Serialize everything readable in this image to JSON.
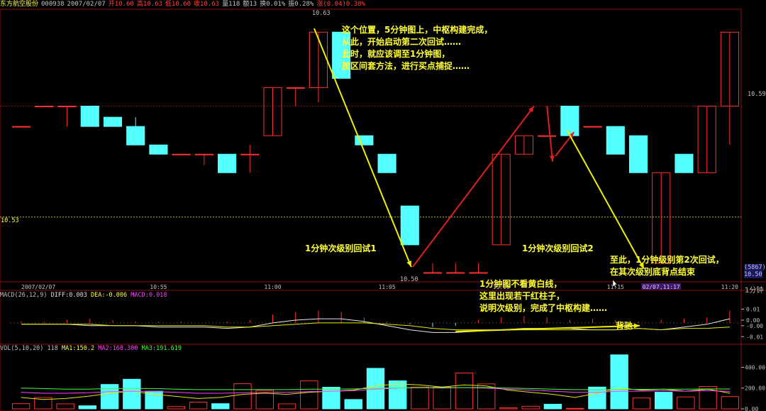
{
  "header": {
    "name": "东方航空股份",
    "code": "000938",
    "date": "2007/02/07",
    "open": "开10.60",
    "high": "高10.63",
    "low": "低10.60",
    "close": "收10.63",
    "volume": "量118",
    "amount": "额13",
    "turnover": "换0.01%",
    "amplitude": "振0.28%",
    "change": "涨(0.04)0.38%"
  },
  "axis": {
    "price_high_label": "10.59",
    "price_mid_label": "10.53",
    "top_candle_label": "10.63",
    "low_label": "10.50",
    "right_box_top": "(5867)",
    "right_box_bottom": "10.50",
    "period": "1分钟",
    "time_labels": [
      "2007/02/07",
      "10:55",
      "11:00",
      "11:05",
      "11:10",
      "11:15",
      "02/07,11:17",
      "11:20"
    ],
    "macd_ticks": [
      "0.01",
      "0.00",
      "-0.00",
      "-0.01"
    ],
    "vol_ticks": [
      "400.00",
      "200.00",
      "0.00"
    ]
  },
  "indicators": {
    "macd_label": "MACD(26,12,9)",
    "diff": "DIFF:0.003",
    "dea": "DEA:-0.006",
    "macd": "MACD:0.018",
    "vol_label": "VOL(5,10,20)",
    "vol_value": "118",
    "ma1": "MA1:150.2",
    "ma2": "MA2:168.300",
    "ma3": "MA3:191.619"
  },
  "annotations": {
    "top": [
      "这个位置，5分钟图上，中枢构建完成，",
      "从此，开始启动第二次回试……",
      "此时，就应该调至1分钟图，",
      "按区间套方法，进行买点捕捉……"
    ],
    "retest1": "1分钟次级别回试1",
    "retest2": "1分钟次级别回试2",
    "end": [
      "至此，1分钟级别第2次回试，",
      "在其次级别底背点结束"
    ],
    "macd_note": [
      "1分钟图不看黄白线，",
      "这里出现若干红柱子，",
      "说明次级别，完成了中枢构建……"
    ],
    "divergence": "背驰"
  },
  "colors": {
    "up": "#ff3030",
    "down": "#54ffff",
    "text": "#c0c0c0",
    "annotation": "#ffff33",
    "grid": "#8a1010"
  },
  "chart_data": {
    "type": "candlestick",
    "ylim": [
      10.495,
      10.642
    ],
    "candles": [
      {
        "o": 10.579,
        "h": 10.579,
        "l": 10.579,
        "c": 10.579
      },
      {
        "o": 10.59,
        "h": 10.59,
        "l": 10.59,
        "c": 10.59
      },
      {
        "o": 10.59,
        "h": 10.59,
        "l": 10.579,
        "c": 10.59
      },
      {
        "o": 10.59,
        "h": 10.59,
        "l": 10.579,
        "c": 10.579
      },
      {
        "o": 10.584,
        "h": 10.584,
        "l": 10.579,
        "c": 10.579
      },
      {
        "o": 10.579,
        "h": 10.584,
        "l": 10.569,
        "c": 10.569
      },
      {
        "o": 10.569,
        "h": 10.569,
        "l": 10.564,
        "c": 10.564
      },
      {
        "o": 10.564,
        "h": 10.564,
        "l": 10.564,
        "c": 10.564
      },
      {
        "o": 10.564,
        "h": 10.564,
        "l": 10.558,
        "c": 10.564
      },
      {
        "o": 10.564,
        "h": 10.564,
        "l": 10.554,
        "c": 10.554
      },
      {
        "o": 10.564,
        "h": 10.569,
        "l": 10.554,
        "c": 10.564
      },
      {
        "o": 10.574,
        "h": 10.6,
        "l": 10.574,
        "c": 10.6
      },
      {
        "o": 10.6,
        "h": 10.6,
        "l": 10.59,
        "c": 10.6
      },
      {
        "o": 10.6,
        "h": 10.63,
        "l": 10.592,
        "c": 10.63
      },
      {
        "o": 10.63,
        "h": 10.63,
        "l": 10.605,
        "c": 10.605
      },
      {
        "o": 10.574,
        "h": 10.574,
        "l": 10.569,
        "c": 10.569
      },
      {
        "o": 10.564,
        "h": 10.564,
        "l": 10.554,
        "c": 10.554
      },
      {
        "o": 10.536,
        "h": 10.536,
        "l": 10.515,
        "c": 10.515
      },
      {
        "o": 10.5,
        "h": 10.505,
        "l": 10.5,
        "c": 10.5
      },
      {
        "o": 10.5,
        "h": 10.505,
        "l": 10.5,
        "c": 10.5
      },
      {
        "o": 10.5,
        "h": 10.505,
        "l": 10.5,
        "c": 10.5
      },
      {
        "o": 10.515,
        "h": 10.564,
        "l": 10.515,
        "c": 10.564
      },
      {
        "o": 10.564,
        "h": 10.574,
        "l": 10.564,
        "c": 10.574
      },
      {
        "o": 10.574,
        "h": 10.574,
        "l": 10.574,
        "c": 10.574
      },
      {
        "o": 10.59,
        "h": 10.59,
        "l": 10.574,
        "c": 10.574
      },
      {
        "o": 10.579,
        "h": 10.579,
        "l": 10.579,
        "c": 10.579
      },
      {
        "o": 10.579,
        "h": 10.579,
        "l": 10.564,
        "c": 10.564
      },
      {
        "o": 10.574,
        "h": 10.574,
        "l": 10.554,
        "c": 10.554
      },
      {
        "o": 10.505,
        "h": 10.554,
        "l": 10.505,
        "c": 10.554
      },
      {
        "o": 10.564,
        "h": 10.564,
        "l": 10.554,
        "c": 10.554
      },
      {
        "o": 10.554,
        "h": 10.59,
        "l": 10.554,
        "c": 10.59
      },
      {
        "o": 10.59,
        "h": 10.63,
        "l": 10.569,
        "c": 10.63
      }
    ],
    "macd": {
      "ylim": [
        -0.014,
        0.018
      ],
      "bars": [
        0.001,
        0.001,
        0.002,
        0.003,
        0.002,
        0.001,
        0.001,
        0.001,
        0.0,
        0.001,
        0.002,
        0.006,
        0.008,
        0.009,
        0.008,
        0.004,
        0.001,
        -0.001,
        -0.003,
        -0.002,
        0.002,
        0.004,
        0.005,
        0.004,
        0.002,
        0.003,
        0.002,
        0.001,
        0.002,
        0.003,
        0.004,
        0.009
      ],
      "diff": [
        -0.001,
        -0.001,
        -0.001,
        -0.002,
        -0.002,
        -0.002,
        -0.003,
        -0.003,
        -0.003,
        -0.004,
        -0.003,
        0.0,
        0.002,
        0.003,
        0.003,
        0.001,
        -0.002,
        -0.005,
        -0.007,
        -0.007,
        -0.006,
        -0.005,
        -0.004,
        -0.004,
        -0.004,
        -0.005,
        -0.005,
        -0.004,
        -0.005,
        -0.003,
        -0.001,
        0.003
      ],
      "dea": [
        -0.001,
        -0.001,
        -0.001,
        -0.001,
        -0.002,
        -0.002,
        -0.002,
        -0.002,
        -0.002,
        -0.003,
        -0.003,
        -0.002,
        -0.001,
        0.0,
        0.0,
        0.0,
        -0.001,
        -0.002,
        -0.004,
        -0.005,
        -0.005,
        -0.005,
        -0.005,
        -0.005,
        -0.005,
        -0.005,
        -0.005,
        -0.004,
        -0.005,
        -0.004,
        -0.004,
        -0.003
      ]
    },
    "volume": {
      "ylim": [
        0,
        560
      ],
      "bars": [
        50,
        110,
        48,
        30,
        235,
        285,
        170,
        22,
        65,
        50,
        242,
        178,
        48,
        270,
        208,
        90,
        390,
        270,
        210,
        210,
        345,
        240,
        10,
        25,
        45,
        5,
        210,
        520,
        105,
        160,
        115,
        215,
        118
      ],
      "ma1": [
        110,
        90,
        100,
        120,
        150,
        170,
        140,
        120,
        100,
        110,
        140,
        150,
        140,
        160,
        170,
        180,
        220,
        240,
        230,
        210,
        230,
        220,
        180,
        160,
        140,
        110,
        150,
        200,
        180,
        190,
        170,
        190,
        150
      ],
      "ma2": [
        160,
        150,
        150,
        155,
        165,
        170,
        165,
        160,
        150,
        150,
        155,
        160,
        160,
        165,
        170,
        175,
        190,
        200,
        205,
        200,
        205,
        200,
        190,
        180,
        170,
        160,
        160,
        170,
        170,
        175,
        170,
        175,
        168
      ],
      "ma3": [
        200,
        195,
        190,
        190,
        195,
        195,
        195,
        190,
        185,
        185,
        185,
        185,
        185,
        190,
        190,
        192,
        198,
        202,
        205,
        205,
        205,
        205,
        200,
        195,
        190,
        185,
        185,
        188,
        188,
        190,
        190,
        192,
        191
      ]
    }
  }
}
